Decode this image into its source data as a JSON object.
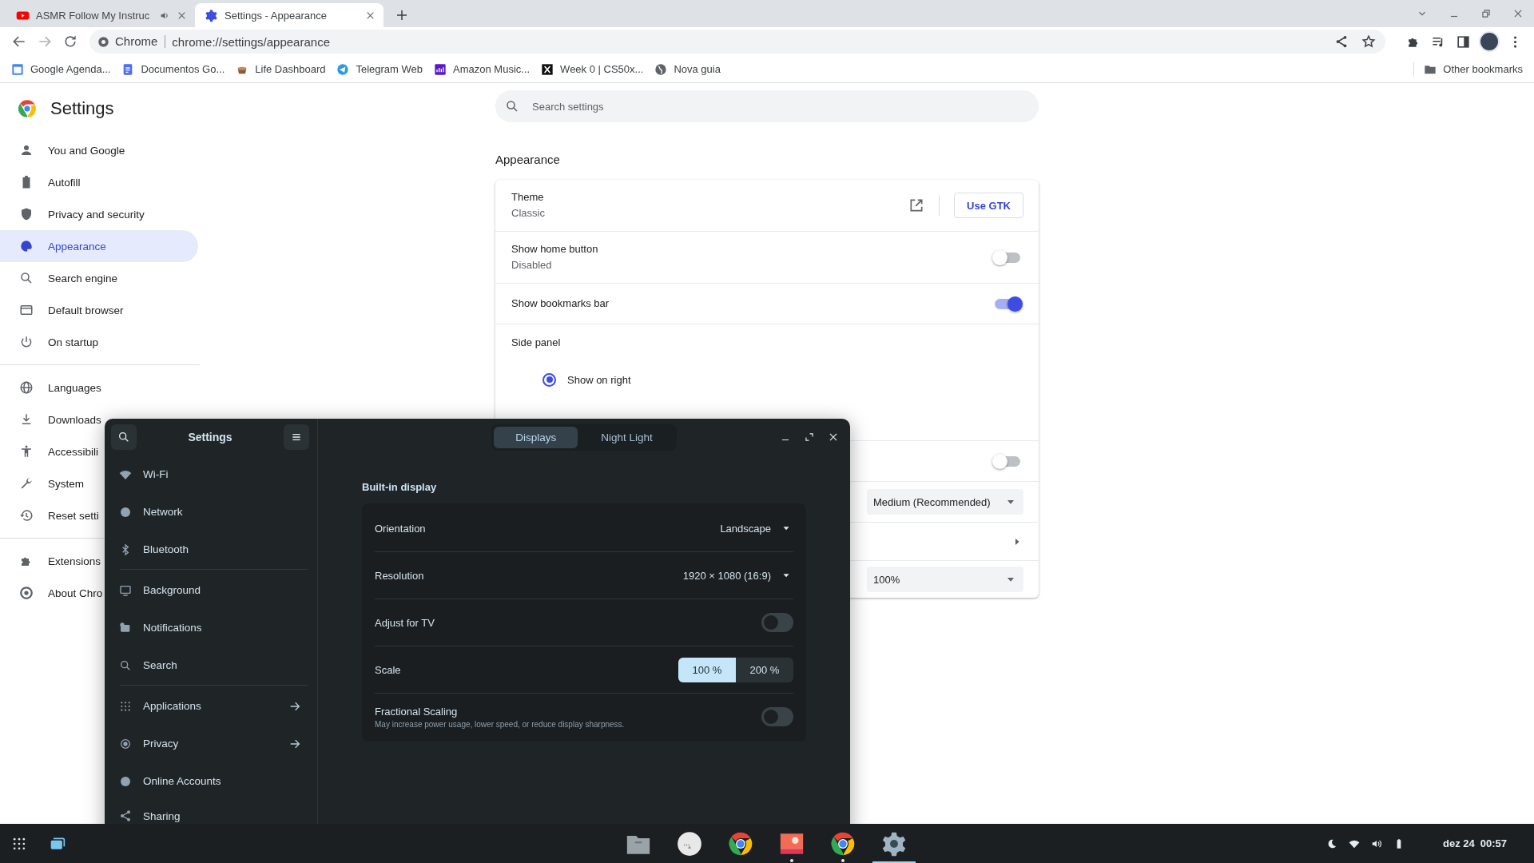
{
  "browser": {
    "tabs": [
      {
        "title": "ASMR Follow My Instruc",
        "selected": false
      },
      {
        "title": "Settings - Appearance",
        "selected": true
      }
    ],
    "omnibox": {
      "chip": "Chrome",
      "url": "chrome://settings/appearance"
    },
    "bookmarks": [
      {
        "title": "Google Agenda..."
      },
      {
        "title": "Documentos Go..."
      },
      {
        "title": "Life Dashboard"
      },
      {
        "title": "Telegram Web"
      },
      {
        "title": "Amazon Music..."
      },
      {
        "title": "Week 0 | CS50x..."
      },
      {
        "title": "Nova guia"
      }
    ],
    "other_bookmarks": "Other bookmarks"
  },
  "settings_page": {
    "title": "Settings",
    "search": {
      "placeholder": "Search settings"
    },
    "nav": [
      [
        {
          "label": "You and Google",
          "selected": false
        },
        {
          "label": "Autofill",
          "selected": false
        },
        {
          "label": "Privacy and security",
          "selected": false
        },
        {
          "label": "Appearance",
          "selected": true
        },
        {
          "label": "Search engine",
          "selected": false
        },
        {
          "label": "Default browser",
          "selected": false
        },
        {
          "label": "On startup",
          "selected": false
        }
      ],
      [
        {
          "label": "Languages",
          "selected": false
        },
        {
          "label": "Downloads",
          "selected": false
        },
        {
          "label": "Accessibili",
          "selected": false
        },
        {
          "label": "System",
          "selected": false
        },
        {
          "label": "Reset setti",
          "selected": false
        }
      ],
      [
        {
          "label": "Extensions",
          "selected": false
        },
        {
          "label": "About Chro",
          "selected": false
        }
      ]
    ],
    "section_title": "Appearance",
    "rows": [
      {
        "kind": "theme",
        "label": "Theme",
        "sublabel": "Classic",
        "button": "Use GTK"
      },
      {
        "kind": "toggle",
        "label": "Show home button",
        "sublabel": "Disabled",
        "on": false
      },
      {
        "kind": "toggle",
        "label": "Show bookmarks bar",
        "on": true
      },
      {
        "kind": "radio_group",
        "label": "Side panel",
        "options": [
          {
            "label": "Show on right",
            "selected": true
          }
        ]
      },
      {
        "kind": "toggle",
        "on": false
      },
      {
        "kind": "dropdown",
        "value": "Medium (Recommended)"
      },
      {
        "kind": "link"
      },
      {
        "kind": "dropdown",
        "value": "100%"
      }
    ]
  },
  "gnome_settings": {
    "title": "Settings",
    "sidebar": [
      [
        {
          "label": "Wi-Fi",
          "arrow": false
        },
        {
          "label": "Network",
          "arrow": false
        },
        {
          "label": "Bluetooth",
          "arrow": false
        }
      ],
      [
        {
          "label": "Background",
          "arrow": false
        },
        {
          "label": "Notifications",
          "arrow": false
        },
        {
          "label": "Search",
          "arrow": false
        }
      ],
      [
        {
          "label": "Applications",
          "arrow": true
        },
        {
          "label": "Privacy",
          "arrow": true
        },
        {
          "label": "Online Accounts",
          "arrow": false
        },
        {
          "label": "Sharing",
          "arrow": false
        }
      ]
    ],
    "tabs": [
      {
        "label": "Displays",
        "selected": true
      },
      {
        "label": "Night Light",
        "selected": false
      }
    ],
    "section_title": "Built-in display",
    "rows": [
      {
        "kind": "dropdown",
        "label": "Orientation",
        "value": "Landscape"
      },
      {
        "kind": "dropdown",
        "label": "Resolution",
        "value": "1920 × 1080 (16:9)"
      },
      {
        "kind": "switch",
        "label": "Adjust for TV",
        "on": false
      },
      {
        "kind": "segmented",
        "label": "Scale",
        "options": [
          {
            "label": "100 %",
            "selected": true
          },
          {
            "label": "200 %",
            "selected": false
          }
        ]
      },
      {
        "kind": "switch",
        "label": "Fractional Scaling",
        "description": "May increase power usage, lower speed, or reduce display sharpness.",
        "on": false
      }
    ]
  },
  "taskbar": {
    "dock": [
      {
        "running": false,
        "focused": false
      },
      {
        "running": false,
        "focused": false
      },
      {
        "running": false,
        "focused": false
      },
      {
        "running": true,
        "focused": false
      },
      {
        "running": true,
        "focused": false
      },
      {
        "running": false,
        "focused": true
      }
    ],
    "date": "dez 24",
    "time": "00:57"
  }
}
